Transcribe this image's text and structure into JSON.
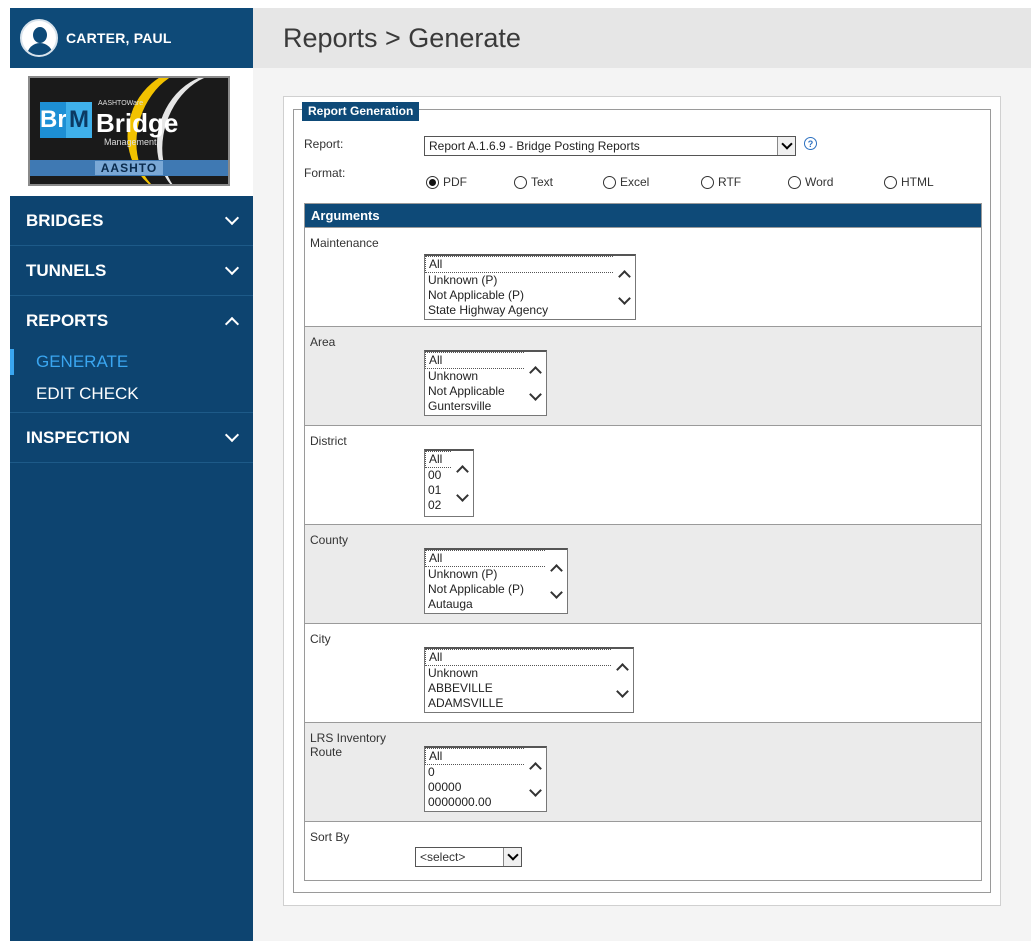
{
  "user": {
    "name": "CARTER, PAUL"
  },
  "logo": {
    "brand_b": "Br",
    "brand_m": "M",
    "small": "AASHTOWare",
    "product": "Bridge",
    "sub": "Management",
    "band": "AASHTO"
  },
  "nav": {
    "bridges": "BRIDGES",
    "tunnels": "TUNNELS",
    "reports": "REPORTS",
    "reports_sub": {
      "generate": "GENERATE",
      "edit_check": "EDIT CHECK"
    },
    "inspection": "INSPECTION"
  },
  "header": {
    "title": "Reports > Generate"
  },
  "form": {
    "legend": "Report Generation",
    "report_label": "Report:",
    "report_value": "Report A.1.6.9 - Bridge Posting Reports",
    "help_glyph": "?",
    "format_label": "Format:",
    "formats": [
      "PDF",
      "Text",
      "Excel",
      "RTF",
      "Word",
      "HTML"
    ],
    "format_selected": "PDF"
  },
  "arguments": {
    "header": "Arguments",
    "maintenance": {
      "label": "Maintenance",
      "options": [
        "All",
        "Unknown (P)",
        "Not Applicable (P)",
        "State Highway Agency"
      ]
    },
    "area": {
      "label": "Area",
      "options": [
        "All",
        "Unknown",
        "Not Applicable",
        "Guntersville"
      ]
    },
    "district": {
      "label": "District",
      "options": [
        "All",
        "00",
        "01",
        "02"
      ]
    },
    "county": {
      "label": "County",
      "options": [
        "All",
        "Unknown (P)",
        "Not Applicable (P)",
        "Autauga"
      ]
    },
    "city": {
      "label": "City",
      "options": [
        "All",
        "Unknown",
        "ABBEVILLE",
        "ADAMSVILLE"
      ]
    },
    "lrs": {
      "label": "LRS Inventory Route",
      "options": [
        "All",
        "0",
        "00000",
        "0000000.00"
      ]
    },
    "sort": {
      "label": "Sort By",
      "value": "<select>"
    }
  }
}
